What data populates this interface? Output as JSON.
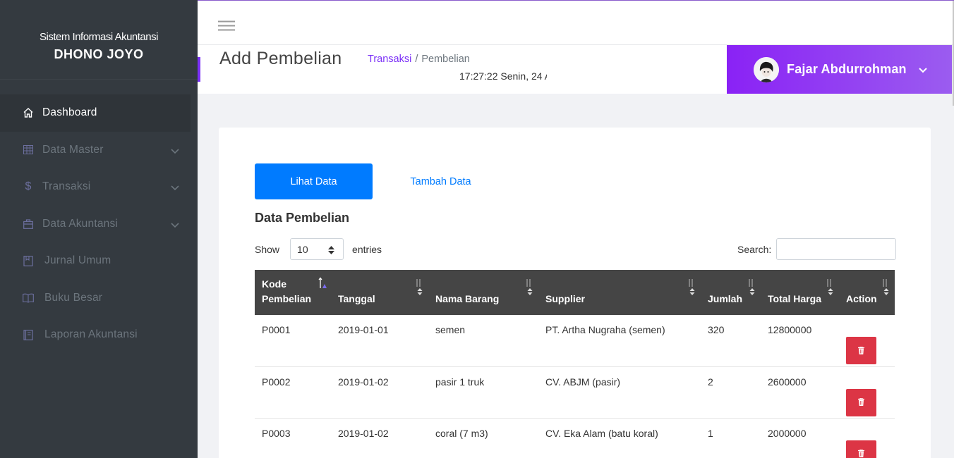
{
  "brand": {
    "subtitle": "Sistem Informasi Akuntansi",
    "name": "DHONO JOYO"
  },
  "sidebar": {
    "items": [
      {
        "label": "Dashboard",
        "icon": "home-icon",
        "active": true,
        "has_children": false
      },
      {
        "label": "Data Master",
        "icon": "table-icon",
        "active": false,
        "has_children": true
      },
      {
        "label": "Transaksi",
        "icon": "dollar-icon",
        "active": false,
        "has_children": true
      },
      {
        "label": "Data Akuntansi",
        "icon": "briefcase-icon",
        "active": false,
        "has_children": true
      },
      {
        "label": "Jurnal Umum",
        "icon": "book-icon",
        "active": false,
        "has_children": false
      },
      {
        "label": "Buku Besar",
        "icon": "open-book-icon",
        "active": false,
        "has_children": false
      },
      {
        "label": "Laporan Akuntansi",
        "icon": "report-icon",
        "active": false,
        "has_children": false
      }
    ]
  },
  "header": {
    "title": "Add Pembelian",
    "breadcrumb": {
      "parent": "Transaksi",
      "separator": "/",
      "current": "Pembelian"
    },
    "clock": "17:27:22 Senin, 24 A"
  },
  "user": {
    "name": "Fajar Abdurrohman"
  },
  "tabs": {
    "view": "Lihat Data",
    "add": "Tambah Data"
  },
  "section_title": "Data Pembelian",
  "table_controls": {
    "show_label": "Show",
    "entries_value": "10",
    "entries_label": "entries",
    "search_label": "Search:"
  },
  "table": {
    "headers": [
      "Kode Pembelian",
      "Tanggal",
      "Nama Barang",
      "Supplier",
      "Jumlah",
      "Total Harga",
      "Action"
    ],
    "header_kode_line1": "Kode",
    "header_kode_line2": "Pembelian",
    "rows": [
      {
        "kode": "P0001",
        "tanggal": "2019-01-01",
        "nama": "semen",
        "supplier": "PT. Artha Nugraha (semen)",
        "jumlah": "320",
        "total": "12800000"
      },
      {
        "kode": "P0002",
        "tanggal": "2019-01-02",
        "nama": "pasir 1 truk",
        "supplier": "CV. ABJM (pasir)",
        "jumlah": "2",
        "total": "2600000"
      },
      {
        "kode": "P0003",
        "tanggal": "2019-01-02",
        "nama": "coral (7 m3)",
        "supplier": "CV. Eka Alam (batu koral)",
        "jumlah": "1",
        "total": "2000000"
      }
    ]
  },
  "colors": {
    "sidebar_bg": "#343a40",
    "accent_purple": "#7b2ff7",
    "primary_blue": "#007bff",
    "danger_red": "#dc3545",
    "table_header": "#454545"
  }
}
